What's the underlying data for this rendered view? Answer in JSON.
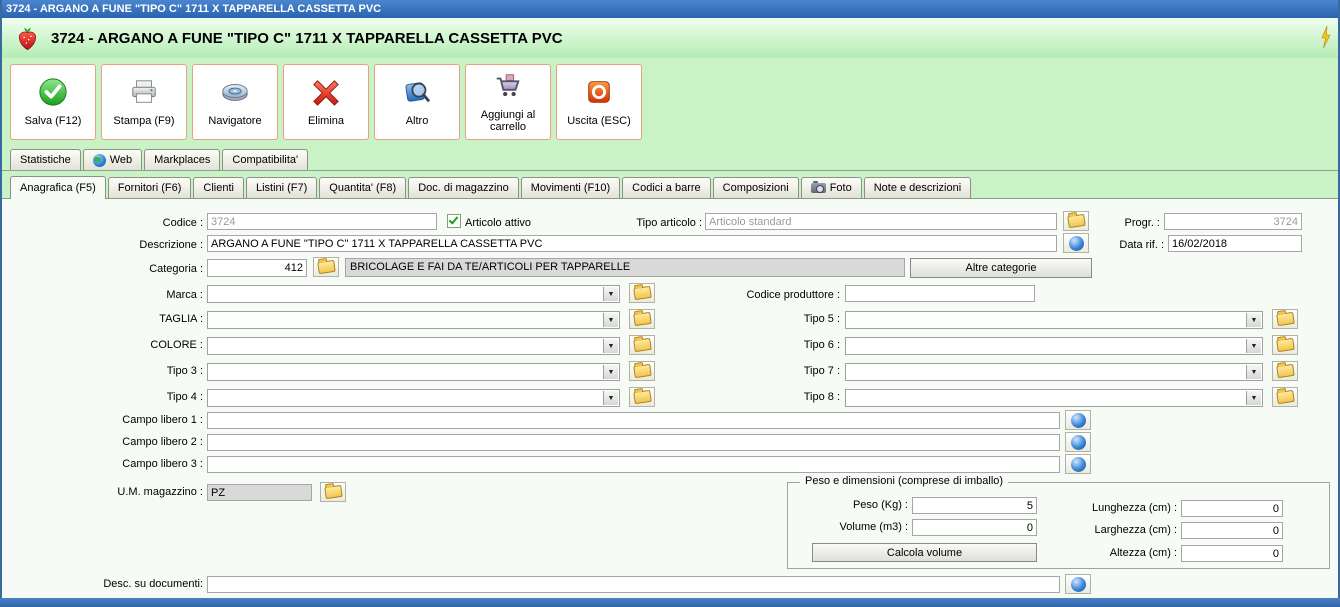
{
  "window": {
    "titlebar": "3724 - ARGANO A FUNE \"TIPO C\" 1711 X TAPPARELLA CASSETTA PVC",
    "header_title": "3724 - ARGANO A FUNE \"TIPO C\" 1711 X TAPPARELLA CASSETTA PVC"
  },
  "colors": {
    "titlebar_blue": "#3a6fb5",
    "window_green": "#c9f3c7",
    "panel_bg": "#f7fbf5",
    "toolbar_button_border": "#e5a47c",
    "readonly_gray": "#d9d9d9",
    "check_green": "#18a018"
  },
  "icons": {
    "logo": "strawberry-icon",
    "save": "green-check-icon",
    "print": "printer-icon",
    "navigator": "disc-icon",
    "delete": "red-x-icon",
    "other": "magnifier-icon",
    "cart": "shopping-cart-icon",
    "exit": "power-icon",
    "web_tab": "globe-icon",
    "foto_tab": "camera-icon",
    "folder_buttons": "folder-icon",
    "ball_buttons": "blue-sphere-icon",
    "dropdowns": "chevron-down-icon",
    "header_right": "lightning-icon"
  },
  "toolbar": {
    "buttons": [
      {
        "label": "Salva (F12)"
      },
      {
        "label": "Stampa (F9)"
      },
      {
        "label": "Navigatore"
      },
      {
        "label": "Elimina"
      },
      {
        "label": "Altro"
      },
      {
        "label": "Aggiungi al carrello"
      },
      {
        "label": "Uscita (ESC)"
      }
    ]
  },
  "tabs_top": {
    "items": [
      {
        "label": "Statistiche"
      },
      {
        "label": "Web"
      },
      {
        "label": "Markplaces"
      },
      {
        "label": "Compatibilita'"
      }
    ]
  },
  "tabs_main": {
    "items": [
      {
        "label": "Anagrafica (F5)"
      },
      {
        "label": "Fornitori (F6)"
      },
      {
        "label": "Clienti"
      },
      {
        "label": "Listini (F7)"
      },
      {
        "label": "Quantita' (F8)"
      },
      {
        "label": "Doc. di magazzino"
      },
      {
        "label": "Movimenti (F10)"
      },
      {
        "label": "Codici a barre"
      },
      {
        "label": "Composizioni"
      },
      {
        "label": "Foto"
      },
      {
        "label": "Note e descrizioni"
      }
    ]
  },
  "form": {
    "codice_label": "Codice :",
    "codice_value": "3724",
    "articolo_attivo_label": "Articolo attivo",
    "articolo_attivo_checked": "true",
    "tipo_articolo_label": "Tipo articolo :",
    "tipo_articolo_value": "Articolo standard",
    "progr_label": "Progr. :",
    "progr_value": "3724",
    "descrizione_label": "Descrizione :",
    "descrizione_value": "ARGANO A FUNE \"TIPO C\" 1711 X TAPPARELLA CASSETTA PVC",
    "data_rif_label": "Data rif. :",
    "data_rif_value": "16/02/2018",
    "categoria_label": "Categoria :",
    "categoria_code": "412",
    "categoria_desc": "BRICOLAGE E FAI DA TE/ARTICOLI PER TAPPARELLE",
    "altre_categorie_label": "Altre categorie",
    "marca_label": "Marca :",
    "codice_produttore_label": "Codice produttore :",
    "attr_left": [
      {
        "label": "TAGLIA :"
      },
      {
        "label": "COLORE :"
      },
      {
        "label": "Tipo 3 :"
      },
      {
        "label": "Tipo 4 :"
      }
    ],
    "attr_right": [
      {
        "label": "Tipo 5 :"
      },
      {
        "label": "Tipo 6 :"
      },
      {
        "label": "Tipo 7 :"
      },
      {
        "label": "Tipo 8 :"
      }
    ],
    "campo_libero": [
      {
        "label": "Campo libero 1 :"
      },
      {
        "label": "Campo libero 2 :"
      },
      {
        "label": "Campo libero 3 :"
      }
    ],
    "um_label": "U.M. magazzino :",
    "um_value": "PZ",
    "peso_box": {
      "title": "Peso e dimensioni (comprese di imballo)",
      "peso_label": "Peso (Kg) :",
      "peso_value": "5",
      "volume_label": "Volume (m3) :",
      "volume_value": "0",
      "calcola_label": "Calcola volume",
      "lunghezza_label": "Lunghezza (cm) :",
      "lunghezza_value": "0",
      "larghezza_label": "Larghezza (cm) :",
      "larghezza_value": "0",
      "altezza_label": "Altezza (cm) :",
      "altezza_value": "0"
    },
    "desc_documenti_label": "Desc. su documenti:"
  }
}
